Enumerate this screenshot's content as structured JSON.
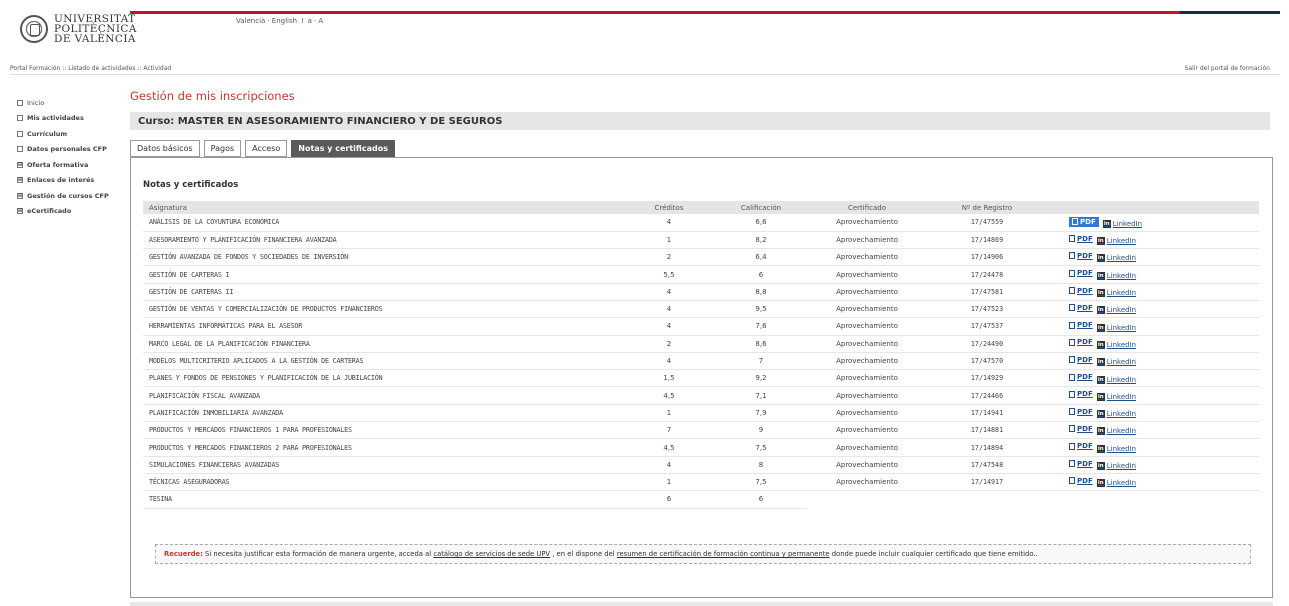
{
  "brand": {
    "logo_lines": [
      "UNIVERSITAT",
      "POLITÈCNICA",
      "DE VALÈNCIA"
    ],
    "accent_color": "#c8102e"
  },
  "language_bar": {
    "lang1": "Valencià",
    "lang2": "English",
    "sep": "I",
    "size_small": "a",
    "size_large": "A"
  },
  "breadcrumb": {
    "text": "Portal Formación :: Listado de actividades :: Actividad",
    "exit_link": "Salir del portal de formación"
  },
  "sidebar": {
    "items": [
      {
        "label": "Inicio",
        "marker": ""
      },
      {
        "label": "Mis actividades",
        "marker": ""
      },
      {
        "label": "Currículum",
        "marker": ""
      },
      {
        "label": "Datos personales CFP",
        "marker": ""
      },
      {
        "label": "Oferta formativa",
        "marker": "⊞"
      },
      {
        "label": "Enlaces de interés",
        "marker": "⊞"
      },
      {
        "label": "Gestión de cursos CFP",
        "marker": "⊞"
      },
      {
        "label": "eCertificado",
        "marker": "⊞"
      }
    ]
  },
  "main": {
    "page_title": "Gestión de mis inscripciones",
    "course_title": "Curso: MASTER EN ASESORAMIENTO FINANCIERO Y DE SEGUROS",
    "tabs": [
      {
        "label": "Datos básicos"
      },
      {
        "label": "Pagos"
      },
      {
        "label": "Acceso"
      },
      {
        "label": "Notas y certificados",
        "active": true
      }
    ],
    "section_title": "Notas y certificados",
    "table": {
      "headers": [
        "Asignatura",
        "Créditos",
        "Calificación",
        "Certificado",
        "Nº de Registro"
      ],
      "pdf_label": "PDF",
      "linkedin_label": "LinkedIn",
      "rows": [
        [
          "ANÁLISIS DE LA COYUNTURA ECONÓMICA",
          "4",
          "6,6",
          "Aprovechamiento",
          "17/47559"
        ],
        [
          "ASESORAMIENTO Y PLANIFICACIÓN FINANCIERA AVANZADA",
          "1",
          "8,2",
          "Aprovechamiento",
          "17/14869"
        ],
        [
          "GESTIÓN AVANZADA DE FONDOS Y SOCIEDADES DE INVERSIÓN",
          "2",
          "6,4",
          "Aprovechamiento",
          "17/14906"
        ],
        [
          "GESTIÓN DE CARTERAS I",
          "5,5",
          "6",
          "Aprovechamiento",
          "17/24478"
        ],
        [
          "GESTIÓN DE CARTERAS II",
          "4",
          "8,8",
          "Aprovechamiento",
          "17/47581"
        ],
        [
          "GESTIÓN DE VENTAS Y COMERCIALIZACIÓN DE PRODUCTOS FINANCIEROS",
          "4",
          "9,5",
          "Aprovechamiento",
          "17/47523"
        ],
        [
          "HERRAMIENTAS INFORMÁTICAS PARA EL ASESOR",
          "4",
          "7,6",
          "Aprovechamiento",
          "17/47537"
        ],
        [
          "MARCO LEGAL DE LA PLANIFICACIÓN FINANCIERA",
          "2",
          "8,6",
          "Aprovechamiento",
          "17/24490"
        ],
        [
          "MODELOS MULTICRITERIO APLICADOS A LA GESTIÓN DE CARTERAS",
          "4",
          "7",
          "Aprovechamiento",
          "17/47570"
        ],
        [
          "PLANES Y FONDOS DE PENSIONES Y PLANIFICACIÓN DE LA JUBILACIÓN",
          "1,5",
          "9,2",
          "Aprovechamiento",
          "17/14929"
        ],
        [
          "PLANIFICACIÓN FISCAL AVANZADA",
          "4,5",
          "7,1",
          "Aprovechamiento",
          "17/24466"
        ],
        [
          "PLANIFICACIÓN INMOBILIARIA AVANZADA",
          "1",
          "7,9",
          "Aprovechamiento",
          "17/14941"
        ],
        [
          "PRODUCTOS Y MERCADOS FINANCIEROS 1 PARA PROFESIONALES",
          "7",
          "9",
          "Aprovechamiento",
          "17/14881"
        ],
        [
          "PRODUCTOS Y MERCADOS FINANCIEROS 2 PARA PROFESIONALES",
          "4,5",
          "7,5",
          "Aprovechamiento",
          "17/14894"
        ],
        [
          "SIMULACIONES FINANCIERAS AVANZADAS",
          "4",
          "8",
          "Aprovechamiento",
          "17/47548"
        ],
        [
          "TÉCNICAS ASEGURADORAS",
          "1",
          "7,5",
          "Aprovechamiento",
          "17/14917"
        ],
        [
          "TESINA",
          "6",
          "6",
          "",
          ""
        ]
      ]
    },
    "notice": {
      "label": "Recuerde:",
      "text1": " Si necesita justificar esta formación de manera urgente, acceda al ",
      "link1": "catálogo de servicios de sede UPV",
      "text2": " , en el dispone del ",
      "link2": "resumen de certificación de formación continua y permanente",
      "text3": " donde puede incluir cualquier certificado que tiene emitido.."
    }
  }
}
